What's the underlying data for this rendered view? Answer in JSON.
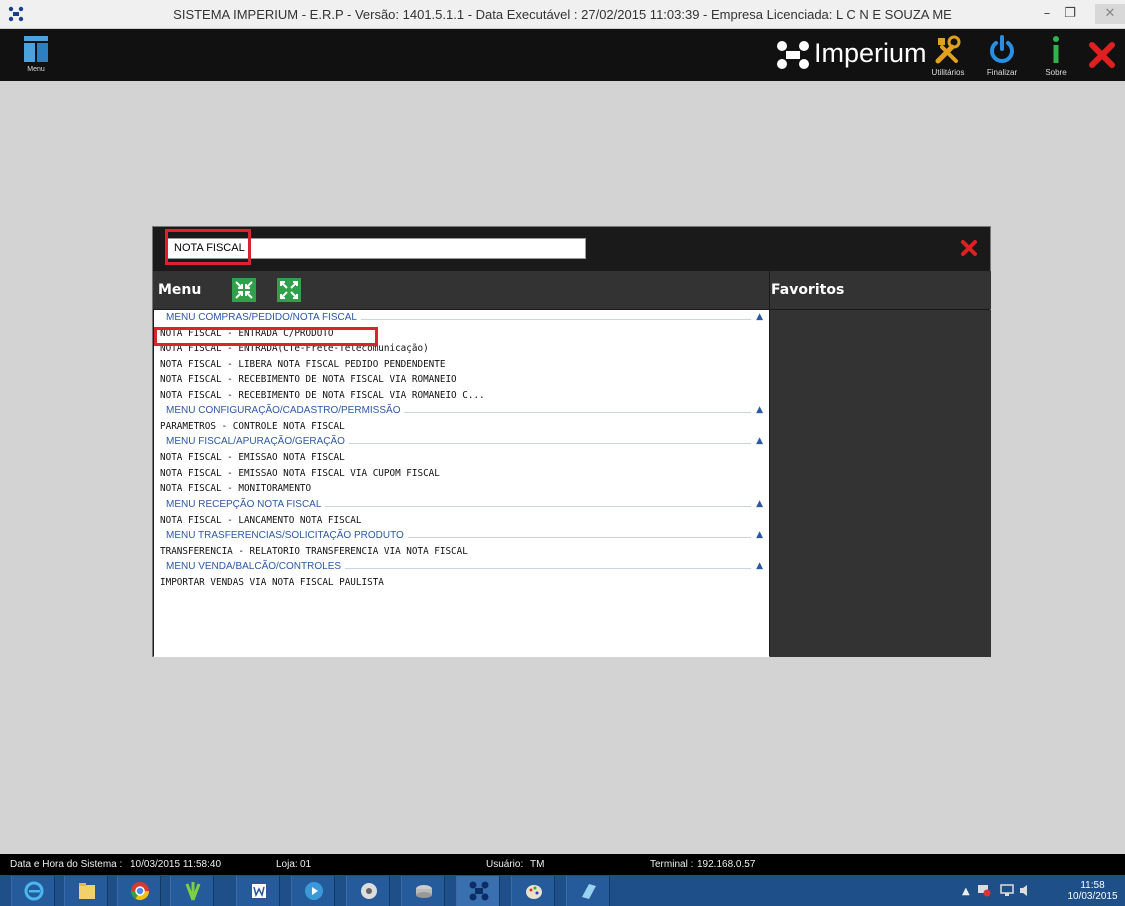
{
  "window": {
    "title": "SISTEMA IMPERIUM - E.R.P - Versão: 1401.5.1.1 - Data Executável : 27/02/2015 11:03:39 - Empresa Licenciada: L C N E SOUZA ME",
    "minimize": "–",
    "maximize": "❐",
    "close": "✕"
  },
  "toolbar": {
    "menu_label": "Menu",
    "brand": "Imperium",
    "tools": [
      {
        "label": "Utilitários",
        "icon": "tools-icon"
      },
      {
        "label": "Finalizar",
        "icon": "power-icon"
      },
      {
        "label": "Sobre",
        "icon": "info-icon"
      }
    ],
    "colors": {
      "utilitarios": "#e0a020",
      "finalizar": "#2a8fe0",
      "sobre": "#2fb34a",
      "close": "#e02020"
    }
  },
  "dialog": {
    "search_value": "NOTA FISCAL",
    "menu_title": "Menu",
    "favorites_title": "Favoritos",
    "groups": [
      {
        "title": "MENU COMPRAS/PEDIDO/NOTA FISCAL",
        "items": [
          "NOTA FISCAL - ENTRADA C/PRODUTO",
          "NOTA FISCAL - ENTRADA(CTe-Frete-Telecomunicação)",
          "NOTA FISCAL - LIBERA NOTA FISCAL PEDIDO PENDENDENTE",
          "NOTA FISCAL - RECEBIMENTO DE NOTA FISCAL VIA ROMANEIO",
          "NOTA FISCAL - RECEBIMENTO DE NOTA FISCAL VIA ROMANEIO C..."
        ]
      },
      {
        "title": "MENU CONFIGURAÇÃO/CADASTRO/PERMISSÃO",
        "items": [
          "PARAMETROS - CONTROLE NOTA FISCAL"
        ]
      },
      {
        "title": "MENU FISCAL/APURAÇÃO/GERAÇÃO",
        "items": [
          "NOTA FISCAL - EMISSAO NOTA FISCAL",
          "NOTA FISCAL - EMISSAO NOTA FISCAL VIA CUPOM FISCAL",
          "NOTA FISCAL - MONITORAMENTO"
        ]
      },
      {
        "title": "MENU RECEPÇÃO NOTA FISCAL",
        "items": [
          "NOTA FISCAL - LANCAMENTO NOTA FISCAL"
        ]
      },
      {
        "title": "MENU TRASFERENCIAS/SOLICITAÇÃO PRODUTO",
        "items": [
          "TRANSFERENCIA - RELATORIO TRANSFERENCIA VIA NOTA FISCAL"
        ]
      },
      {
        "title": "MENU VENDA/BALCÃO/CONTROLES",
        "items": [
          "IMPORTAR VENDAS VIA NOTA FISCAL PAULISTA"
        ]
      }
    ],
    "caret": "▲"
  },
  "status": {
    "datetime_label": "Data e Hora do Sistema :",
    "datetime_value": "10/03/2015 11:58:40",
    "loja_label": "Loja:",
    "loja_value": "01",
    "usuario_label": "Usuário:",
    "usuario_value": "TM",
    "terminal_label": "Terminal :",
    "terminal_value": "192.168.0.57"
  },
  "taskbar": {
    "apps": [
      "internet-explorer-icon",
      "file-explorer-icon",
      "chrome-icon",
      "plant-app-icon",
      "word-icon",
      "media-player-icon",
      "camera-app-icon",
      "database-app-icon",
      "imperium-icon",
      "paint-icon",
      "app-icon"
    ],
    "clock_time": "11:58",
    "clock_date": "10/03/2015"
  }
}
